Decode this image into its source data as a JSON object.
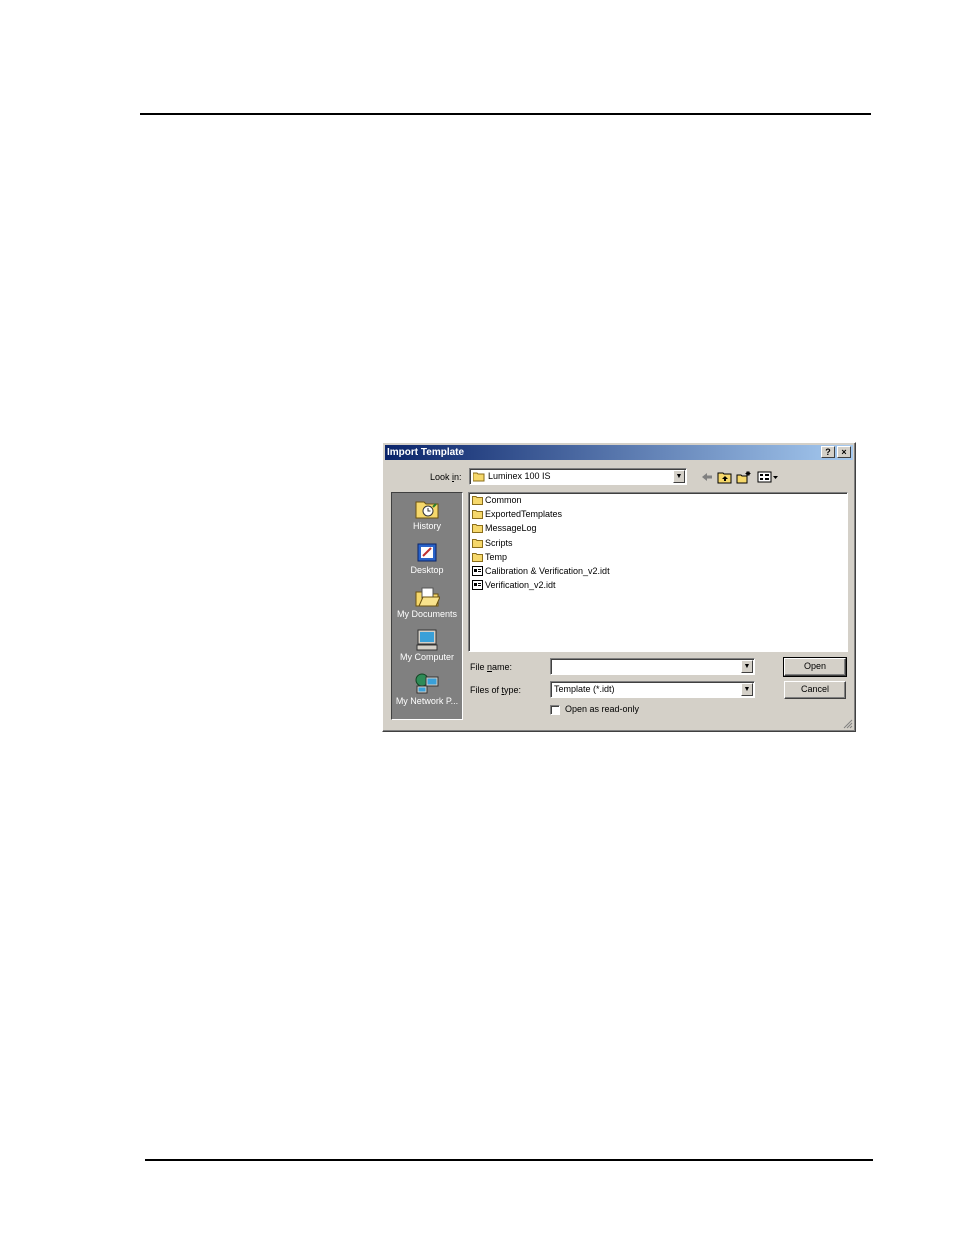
{
  "dialog": {
    "title": "Import Template",
    "help_button": "?",
    "close_button": "×",
    "look_in_label": "Look in:",
    "look_in_value": "Luminex 100 IS",
    "places": [
      {
        "label": "History",
        "icon": "history-icon"
      },
      {
        "label": "Desktop",
        "icon": "desktop-icon"
      },
      {
        "label": "My Documents",
        "icon": "my-documents-icon"
      },
      {
        "label": "My Computer",
        "icon": "my-computer-icon"
      },
      {
        "label": "My Network P...",
        "icon": "my-network-places-icon"
      }
    ],
    "files": [
      {
        "name": "Common",
        "icon": "folder-icon"
      },
      {
        "name": "ExportedTemplates",
        "icon": "folder-icon"
      },
      {
        "name": "MessageLog",
        "icon": "folder-icon"
      },
      {
        "name": "Scripts",
        "icon": "folder-icon"
      },
      {
        "name": "Temp",
        "icon": "folder-icon"
      },
      {
        "name": "Calibration & Verification_v2.idt",
        "icon": "template-file-icon"
      },
      {
        "name": "Verification_v2.idt",
        "icon": "template-file-icon"
      }
    ],
    "file_name_label": "File name:",
    "file_name_value": "",
    "files_of_type_label": "Files of type:",
    "files_of_type_value": "Template (*.idt)",
    "open_button": "Open",
    "cancel_button": "Cancel",
    "read_only_label": "Open as read-only",
    "read_only_checked": false,
    "toolbar_icons": [
      "back-arrow-icon",
      "up-one-level-icon",
      "create-new-folder-icon",
      "views-menu-icon"
    ]
  }
}
